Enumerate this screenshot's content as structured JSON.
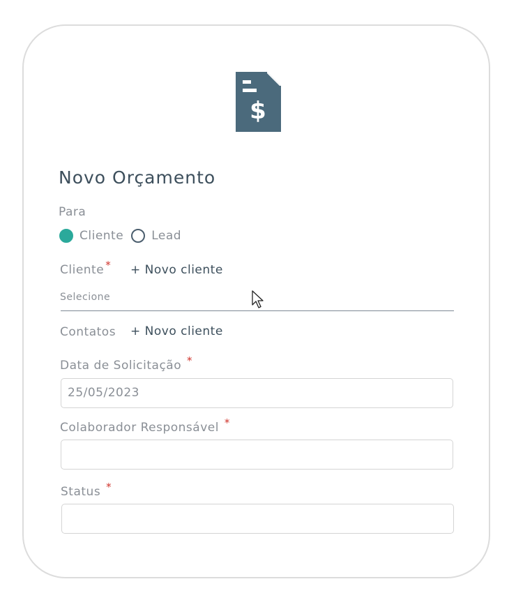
{
  "form": {
    "title": "Novo Orçamento",
    "para_label": "Para",
    "radio_options": [
      {
        "label": "Cliente",
        "selected": true
      },
      {
        "label": "Lead",
        "selected": false
      }
    ],
    "cliente_label": "Cliente",
    "required_mark": "*",
    "novo_cliente_link": "+ Novo cliente",
    "cliente_placeholder": "Selecione",
    "contatos_label": "Contatos",
    "contatos_link": "+ Novo cliente",
    "data_label": "Data de Solicitação",
    "data_value": "25/05/2023",
    "colaborador_label": "Colaborador Responsável",
    "colaborador_value": "",
    "status_label": "Status",
    "status_value": ""
  },
  "icons": {
    "header": "invoice-dollar-icon",
    "cursor": "mouse-pointer-icon"
  },
  "colors": {
    "accent": "#2ba99b",
    "icon": "#4b6a7c",
    "required": "#d0342c",
    "text_dark": "#3d4f5c",
    "text_muted": "#8a8f96"
  }
}
